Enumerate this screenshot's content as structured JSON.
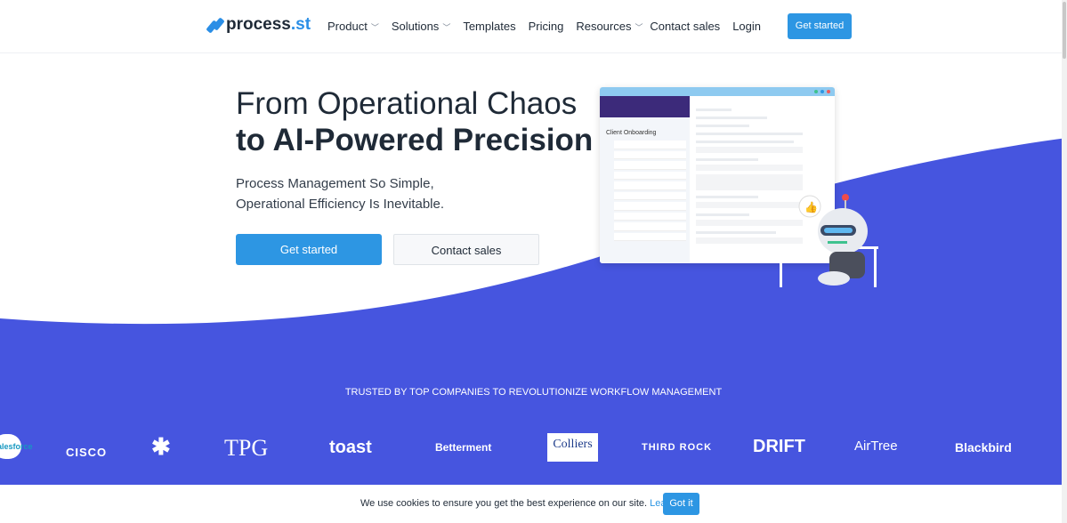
{
  "nav": {
    "logo_text": "process",
    "logo_suffix": ".st",
    "items": [
      "Product",
      "Solutions",
      "Templates",
      "Pricing",
      "Resources"
    ],
    "contact": "Contact sales",
    "login": "Login",
    "cta": "Get started"
  },
  "hero": {
    "title_line1": "From Operational Chaos",
    "title_line2": "to AI-Powered Precision",
    "sub1": "Process Management So Simple,",
    "sub2": "Operational Efficiency Is Inevitable.",
    "cta_primary": "Get started",
    "cta_secondary": "Contact sales"
  },
  "mockup": {
    "checklist_title": "Client Onboarding",
    "window_dots": [
      "#3ec28f",
      "#2d96e3",
      "#ef5b5b"
    ]
  },
  "trusted": {
    "heading": "TRUSTED BY TOP COMPANIES TO REVOLUTIONIZE WORKFLOW MANAGEMENT",
    "logos": [
      "salesforce",
      "CISCO",
      "slack",
      "TPG",
      "toast",
      "Betterment",
      "Colliers",
      "THIRD ROCK",
      "DRIFT",
      "AirTree",
      "Blackbird"
    ]
  },
  "cookie": {
    "text": "We use cookies to ensure you get the best experience on our site.",
    "link": "Learn more",
    "button": "Got it"
  },
  "colors": {
    "brand_blue": "#2d96e3",
    "wave": "#4655df"
  }
}
